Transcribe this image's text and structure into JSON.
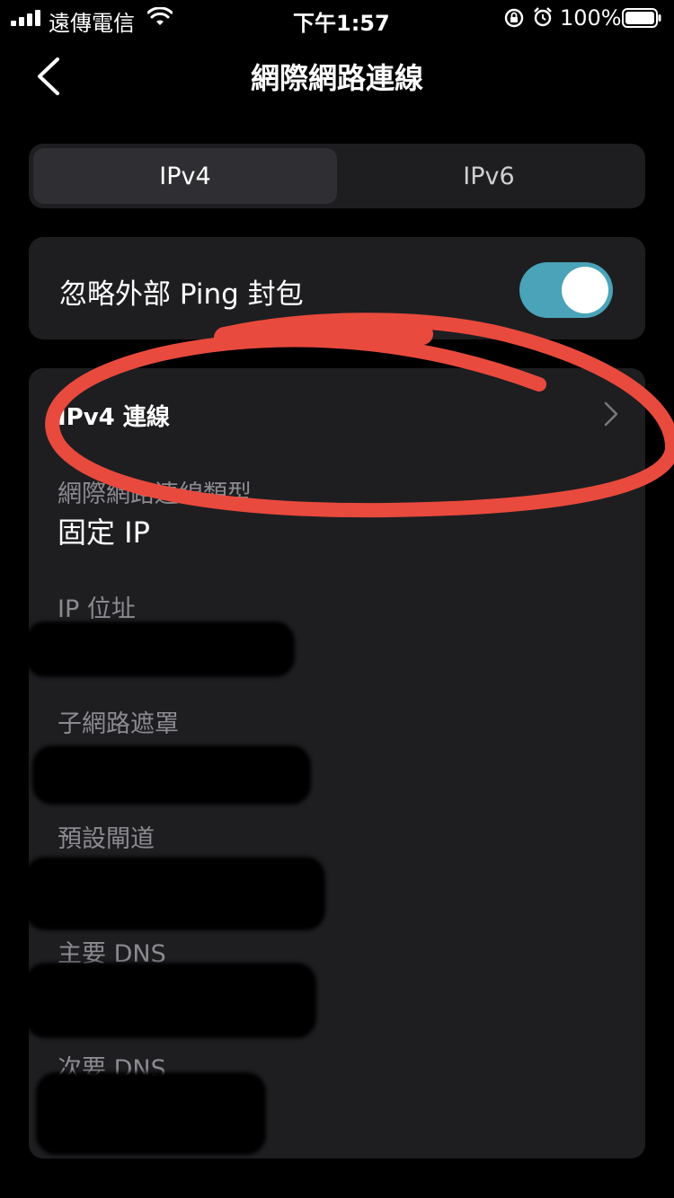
{
  "status_bar": {
    "carrier": "遠傳電信",
    "time": "下午1:57",
    "battery": "100%"
  },
  "nav": {
    "title": "網際網路連線"
  },
  "segmented": {
    "tabs": [
      {
        "label": "IPv4",
        "selected": true
      },
      {
        "label": "IPv6",
        "selected": false
      }
    ]
  },
  "ping": {
    "label": "忽略外部 Ping 封包",
    "enabled": true,
    "toggle_color": "#4aa3b8"
  },
  "ipv4": {
    "row_title": "IPv4 連線",
    "connection_type_label": "網際網路連線類型",
    "connection_type_value": "固定 IP",
    "fields": [
      {
        "label": "IP 位址"
      },
      {
        "label": "子網路遮罩"
      },
      {
        "label": "預設閘道"
      },
      {
        "label": "主要 DNS"
      },
      {
        "label": "次要 DNS"
      }
    ]
  },
  "annotation_color": "#e84a3d"
}
